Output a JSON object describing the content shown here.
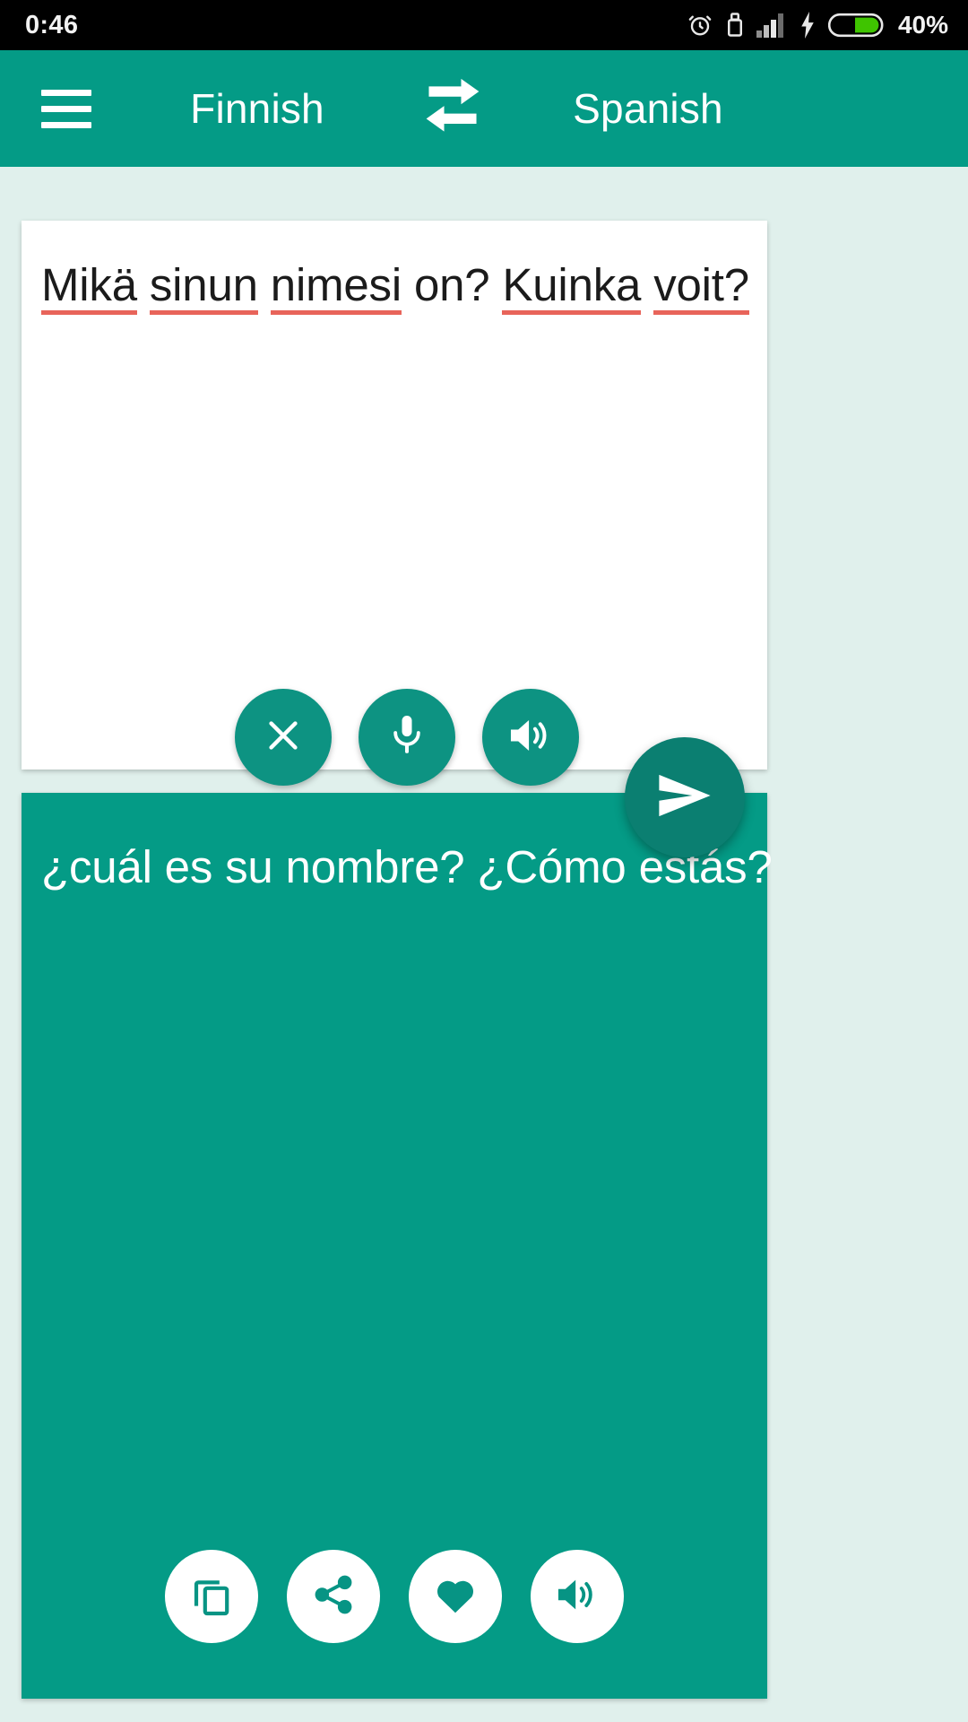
{
  "status_bar": {
    "clock": "0:46",
    "battery_percent": "40%",
    "icons": [
      "alarm-clock-icon",
      "usb-icon",
      "signal-bars-icon",
      "charging-bolt-icon",
      "battery-icon"
    ],
    "battery_fill_color": "#3fc400",
    "background_color": "#000000",
    "text_color": "#f2f2f2"
  },
  "app_bar": {
    "menu_label": "menu",
    "source_language": "Finnish",
    "target_language": "Spanish",
    "swap_label": "swap-languages",
    "background_color": "#049b86",
    "text_color": "#ffffff"
  },
  "source_panel": {
    "words": [
      {
        "text": "Mikä",
        "misspelled": true
      },
      {
        "text": "sinun",
        "misspelled": true
      },
      {
        "text": "nimesi",
        "misspelled": true
      },
      {
        "text": "on?",
        "misspelled": false
      },
      {
        "text": "Kuinka",
        "misspelled": true
      },
      {
        "text": "voit?",
        "misspelled": true
      }
    ],
    "full_text": "Mikä sinun nimesi on? Kuinka voit?",
    "background_color": "#ffffff",
    "text_color": "#1b1b1b",
    "spellcheck_underline_color": "#e8645a",
    "actions": [
      {
        "name": "clear-button",
        "icon": "close-icon"
      },
      {
        "name": "microphone-button",
        "icon": "microphone-icon"
      },
      {
        "name": "speak-source-button",
        "icon": "speaker-icon"
      }
    ],
    "action_button_color": "#0d9382"
  },
  "send_button": {
    "name": "translate-send-button",
    "icon": "send-icon",
    "color": "#0b7f71"
  },
  "target_panel": {
    "translated_text": "¿cuál es su nombre? ¿Cómo estás?",
    "background_color": "#049b86",
    "text_color": "#ffffff",
    "actions": [
      {
        "name": "copy-button",
        "icon": "copy-icon"
      },
      {
        "name": "share-button",
        "icon": "share-icon"
      },
      {
        "name": "favorite-button",
        "icon": "heart-icon"
      },
      {
        "name": "speak-translation-button",
        "icon": "speaker-icon"
      }
    ],
    "action_button_bg": "#ffffff",
    "action_icon_color": "#049b86"
  }
}
